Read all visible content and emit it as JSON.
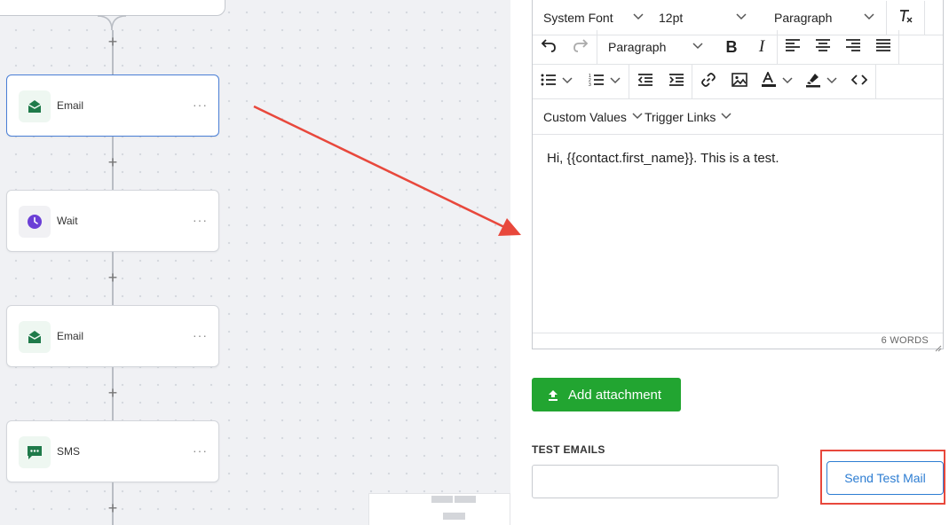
{
  "workflow": {
    "nodes": [
      {
        "label": "Email",
        "icon": "email-icon"
      },
      {
        "label": "Wait",
        "icon": "clock-icon"
      },
      {
        "label": "Email",
        "icon": "email-icon"
      },
      {
        "label": "SMS",
        "icon": "sms-icon"
      }
    ],
    "plus_symbol": "+",
    "menu_symbol": "···"
  },
  "editor": {
    "font_family": "System Font",
    "font_size": "12pt",
    "block_format": "Paragraph",
    "block_format_2": "Paragraph",
    "custom_values": "Custom Values",
    "trigger_links": "Trigger Links",
    "body_text": "Hi, {{contact.first_name}}. This is a test.",
    "word_count": "6 WORDS"
  },
  "attachment": {
    "label": "Add attachment"
  },
  "test_emails": {
    "label": "TEST EMAILS",
    "value": "",
    "send_label": "Send Test Mail"
  },
  "colors": {
    "accent_green": "#22a531",
    "link_blue": "#2d7dd2",
    "annotation_red": "#e8483c",
    "email_icon_green": "#1f7a4a",
    "wait_icon_purple": "#6b3fd6"
  }
}
